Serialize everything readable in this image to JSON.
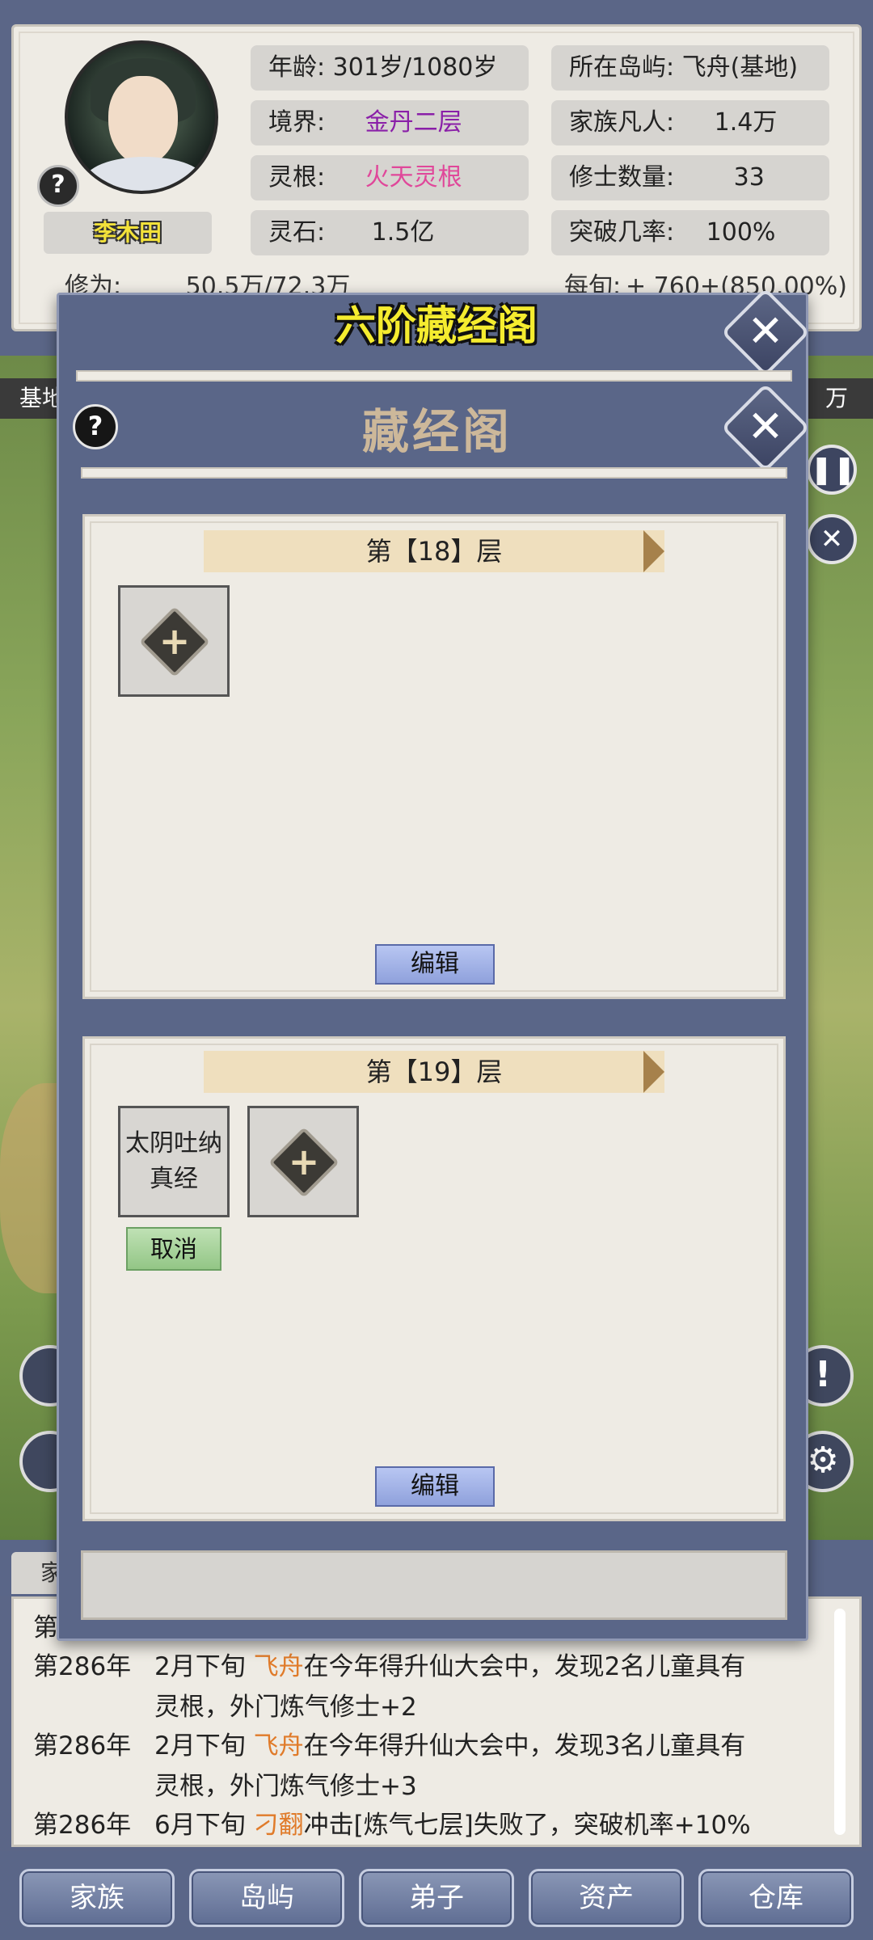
{
  "player": {
    "name": "李木田",
    "age_label": "年龄:",
    "age_value": "301岁/1080岁",
    "island_label": "所在岛屿:",
    "island_value": "飞舟(基地)",
    "realm_label": "境界:",
    "realm_value": "金丹二层",
    "mortals_label": "家族凡人:",
    "mortals_value": "1.4万",
    "root_label": "灵根:",
    "root_value": "火天灵根",
    "cultivators_label": "修士数量:",
    "cultivators_value": "33",
    "stones_label": "灵石:",
    "stones_value": "1.5亿",
    "breakthrough_label": "突破几率:",
    "breakthrough_value": "100%",
    "cultivation_label": "修为:",
    "cultivation_value": "50.5万/72.3万",
    "per_ten_days_label": "每旬:",
    "per_ten_days_value": "+ 760+(850.00%)",
    "colors": {
      "realm": "#8a1fa8",
      "root": "#e0479a",
      "name": "#f3e23a"
    }
  },
  "map": {
    "left_label": "基地",
    "right_label": "万"
  },
  "outer_dialog": {
    "title": "六阶藏经阁",
    "close_icon": "close-icon"
  },
  "inner_dialog": {
    "title": "藏经阁",
    "help": "?",
    "floors": [
      {
        "label": "第【18】层",
        "slots": [
          {
            "type": "add"
          }
        ],
        "edit_label": "编辑"
      },
      {
        "label": "第【19】层",
        "slots": [
          {
            "type": "book",
            "name_line1": "太阴吐纳",
            "name_line2": "真经",
            "cancel_label": "取消"
          },
          {
            "type": "add"
          }
        ],
        "edit_label": "编辑"
      }
    ]
  },
  "log": {
    "tab_label": "家",
    "partial_first": "第",
    "rows": [
      {
        "year": "第286年",
        "text_a": "2月下旬 ",
        "highlight": "飞舟",
        "text_b": "在今年得升仙大会中，发现2名儿童具有"
      },
      {
        "year": "",
        "text_a": "灵根，外门炼气修士+2",
        "highlight": "",
        "text_b": ""
      },
      {
        "year": "第286年",
        "text_a": "2月下旬 ",
        "highlight": "飞舟",
        "text_b": "在今年得升仙大会中，发现3名儿童具有"
      },
      {
        "year": "",
        "text_a": "灵根，外门炼气修士+3",
        "highlight": "",
        "text_b": ""
      },
      {
        "year": "第286年",
        "text_a": "6月下旬 ",
        "highlight": "刁翻",
        "text_b": "冲击[炼气七层]失败了，突破机率+10%"
      }
    ],
    "highlight_color": "#e07b2a"
  },
  "nav": [
    "家族",
    "岛屿",
    "弟子",
    "资产",
    "仓库"
  ],
  "misc": {
    "help_badge": "?",
    "pause_icon": "pause-icon",
    "settings_icon": "gear-icon",
    "alert_icon": "exclamation-icon",
    "plus_glyph": "+",
    "close_glyph": "✕",
    "pause_glyph": "❚❚",
    "gear_glyph": "⚙",
    "alert_glyph": "!"
  }
}
